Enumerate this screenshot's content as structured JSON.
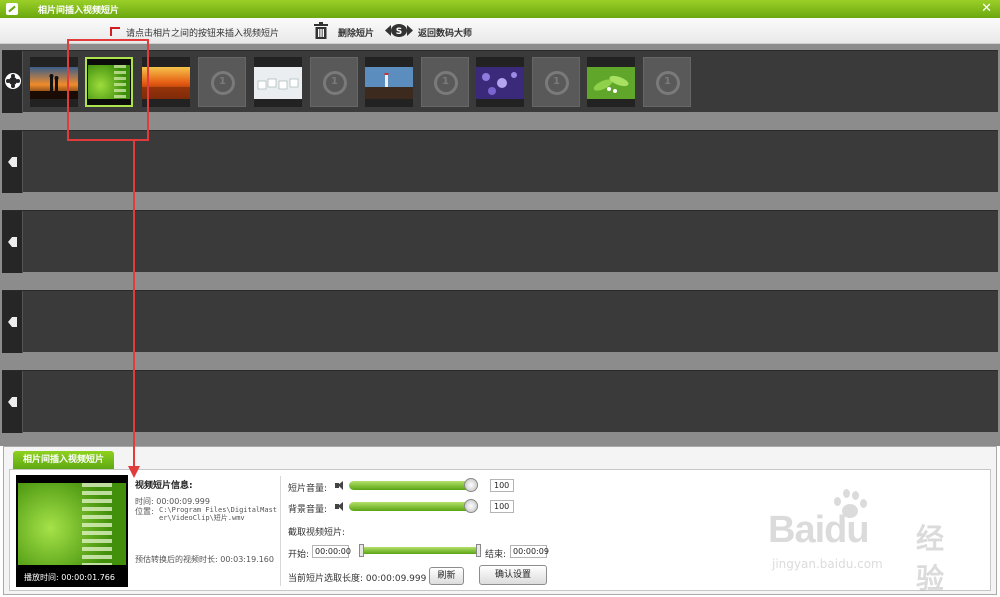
{
  "window": {
    "title": "相片间插入视频短片",
    "close_glyph": "✕"
  },
  "toolbar": {
    "hint": "请点击相片之间的按钮来插入视频短片",
    "delete_label": "删除短片",
    "back_label": "返回数码大师"
  },
  "timeline": {
    "insert_glyph": "1",
    "tracks": 5
  },
  "panel": {
    "tab_label": "相片间插入视频短片",
    "preview": {
      "play_time": "播放时间: 00:00:01.766"
    },
    "info": {
      "heading": "视频短片信息:",
      "time": "时间: 00:00:09.999",
      "location_label": "位置:",
      "location_value": "C:\\Program Files\\DigitalMaster\\VideoClip\\短片.wmv",
      "converted_length": "预估转换后的视频时长: 00:03:19.160"
    },
    "controls": {
      "clip_volume_label": "短片音量:",
      "clip_volume_value": "100",
      "clip_volume": 100,
      "bg_volume_label": "背景音量:",
      "bg_volume_value": "100",
      "bg_volume": 100,
      "crop_heading": "截取视频短片:",
      "start_label": "开始:",
      "start_value": "00:00:00",
      "end_label": "结束:",
      "end_value": "00:00:09",
      "current_length": "当前短片选取长度: 00:00:09.999",
      "refresh_label": "刷新",
      "confirm_label": "确认设置"
    }
  },
  "watermark": {
    "brand": "Baidu",
    "jing": "经验",
    "url": "jingyan.baidu.com"
  }
}
